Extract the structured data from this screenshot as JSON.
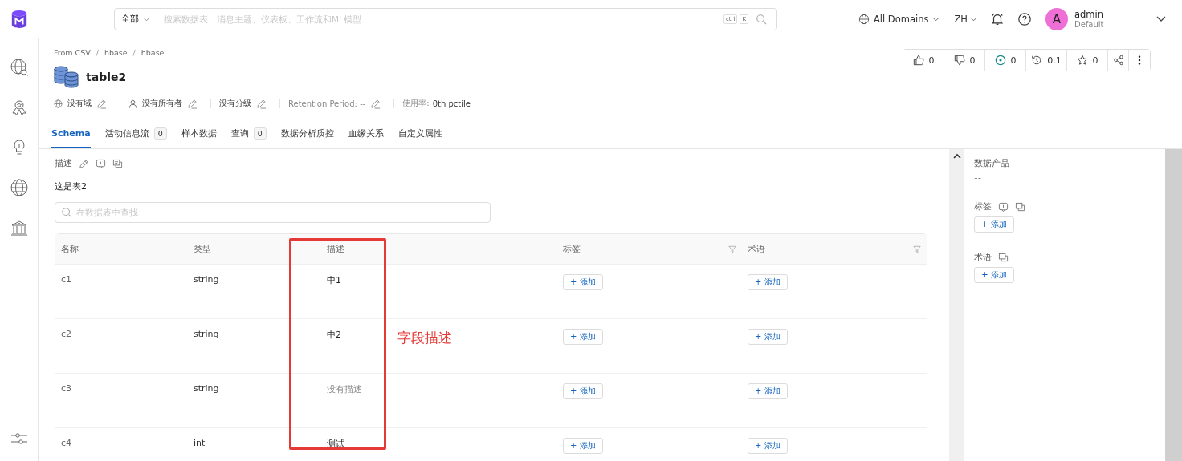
{
  "header": {
    "search_scope": "全部",
    "search_placeholder": "搜索数据表、消息主题、仪表板、工作流和ML模型",
    "shortcut_keys": [
      "ctrl",
      "K"
    ],
    "domain": "All Domains",
    "language": "ZH",
    "user": {
      "initial": "A",
      "name": "admin",
      "role": "Default"
    }
  },
  "breadcrumb": [
    {
      "kind": "link",
      "text": "From CSV"
    },
    {
      "kind": "separator",
      "text": "/"
    },
    {
      "kind": "link",
      "text": "hbase"
    },
    {
      "kind": "separator",
      "text": "/"
    },
    {
      "kind": "link",
      "text": "hbase"
    }
  ],
  "title": "table2",
  "meta": [
    {
      "kind": "domain",
      "text": "没有域"
    },
    {
      "kind": "owner",
      "text": "没有所有者"
    },
    {
      "kind": "tier",
      "text": "没有分级"
    },
    {
      "kind": "retention",
      "text": "Retention Period: --"
    },
    {
      "kind": "usage",
      "text": "使用率:",
      "value": "0th pctile"
    }
  ],
  "actions": [
    {
      "kind": "like",
      "value": "0"
    },
    {
      "kind": "dislike",
      "value": "0"
    },
    {
      "kind": "follow",
      "value": "0"
    },
    {
      "kind": "version",
      "value": "0.1"
    },
    {
      "kind": "star",
      "value": "0"
    }
  ],
  "tabs": [
    {
      "label": "Schema",
      "selected": true
    },
    {
      "label": "活动信息流",
      "count": "0",
      "selected": false
    },
    {
      "label": "样本数据",
      "selected": false
    },
    {
      "label": "查询",
      "count": "0",
      "selected": false
    },
    {
      "label": "数据分析质控",
      "selected": false
    },
    {
      "label": "血缘关系",
      "selected": false
    },
    {
      "label": "自定义属性",
      "selected": false
    }
  ],
  "description": {
    "label": "描述",
    "text": "这是表2"
  },
  "table_search_placeholder": "在数据表中查找",
  "table": {
    "columns": [
      {
        "label": "名称",
        "filter": false
      },
      {
        "label": "类型",
        "filter": false
      },
      {
        "label": "描述",
        "filter": false
      },
      {
        "label": "标签",
        "filter": true
      },
      {
        "label": "术语",
        "filter": true
      }
    ],
    "rows": [
      {
        "name": "c1",
        "type": "string",
        "description": "中1",
        "empty": false,
        "tag_button": "+ 添加",
        "term_button": "+ 添加"
      },
      {
        "name": "c2",
        "type": "string",
        "description": "中2",
        "empty": false,
        "tag_button": "+ 添加",
        "term_button": "+ 添加"
      },
      {
        "name": "c3",
        "type": "string",
        "description": "没有描述",
        "empty": true,
        "tag_button": "+ 添加",
        "term_button": "+ 添加"
      },
      {
        "name": "c4",
        "type": "int",
        "description": "测试",
        "empty": false,
        "tag_button": "+ 添加",
        "term_button": "+ 添加"
      }
    ]
  },
  "annotation": "字段描述",
  "side": {
    "data_products_label": "数据产品",
    "data_products_value": "--",
    "tags_label": "标签",
    "tags_button": "+ 添加",
    "glossary_label": "术语",
    "glossary_button": "+ 添加"
  }
}
